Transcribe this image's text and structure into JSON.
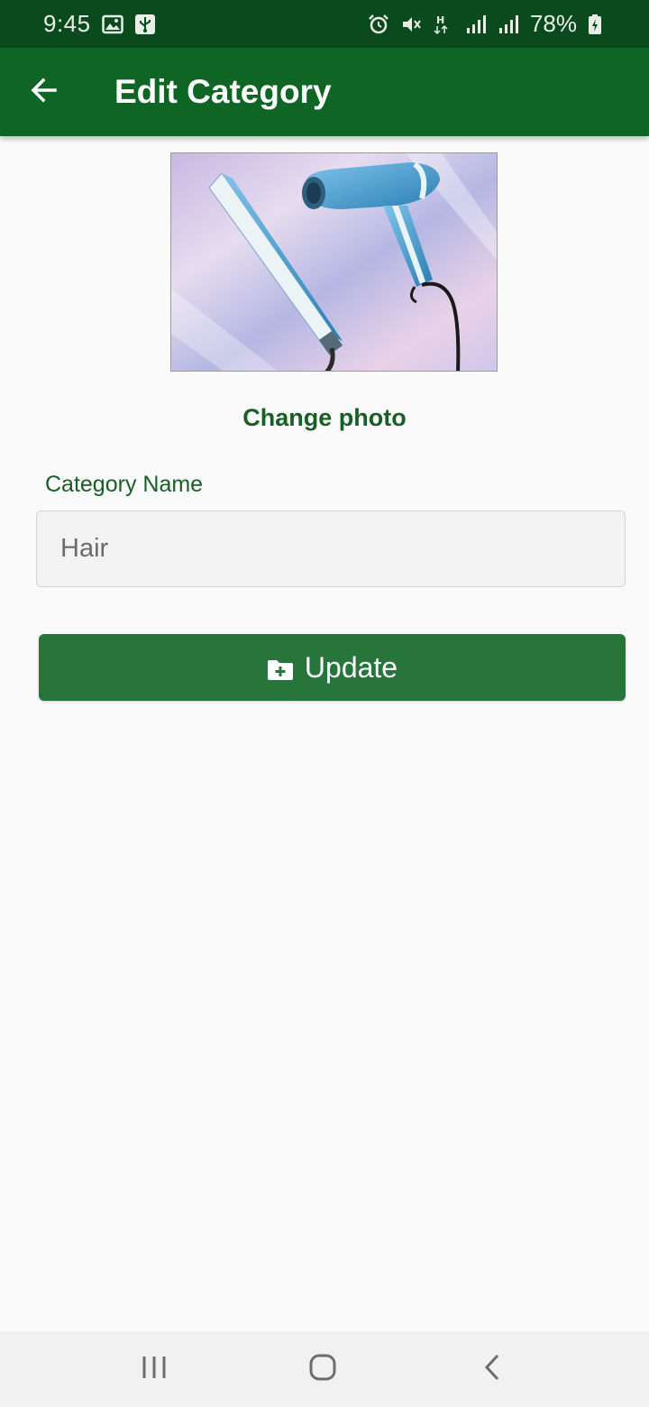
{
  "status_bar": {
    "time": "9:45",
    "battery": "78%",
    "icons_left": [
      "gallery-icon",
      "usb-icon"
    ],
    "icons_right": [
      "alarm-icon",
      "mute-icon",
      "data-h-icon",
      "signal-icon",
      "signal-icon",
      "battery-icon"
    ]
  },
  "app_bar": {
    "title": "Edit Category",
    "back_icon": "arrow-left-icon",
    "background": "#0f6524"
  },
  "photo": {
    "description_icon": "hair-tools-photo"
  },
  "change_photo_label": "Change photo",
  "form": {
    "category_label": "Category Name",
    "category_value": "Hair"
  },
  "update_button": {
    "label": "Update",
    "icon": "folder-plus-icon",
    "color": "#27753b"
  },
  "nav_bar": {
    "icons": [
      "recents-icon",
      "home-icon",
      "back-icon"
    ]
  },
  "colors": {
    "status_bar": "#0b4a1c",
    "accent_text": "#175f24"
  }
}
